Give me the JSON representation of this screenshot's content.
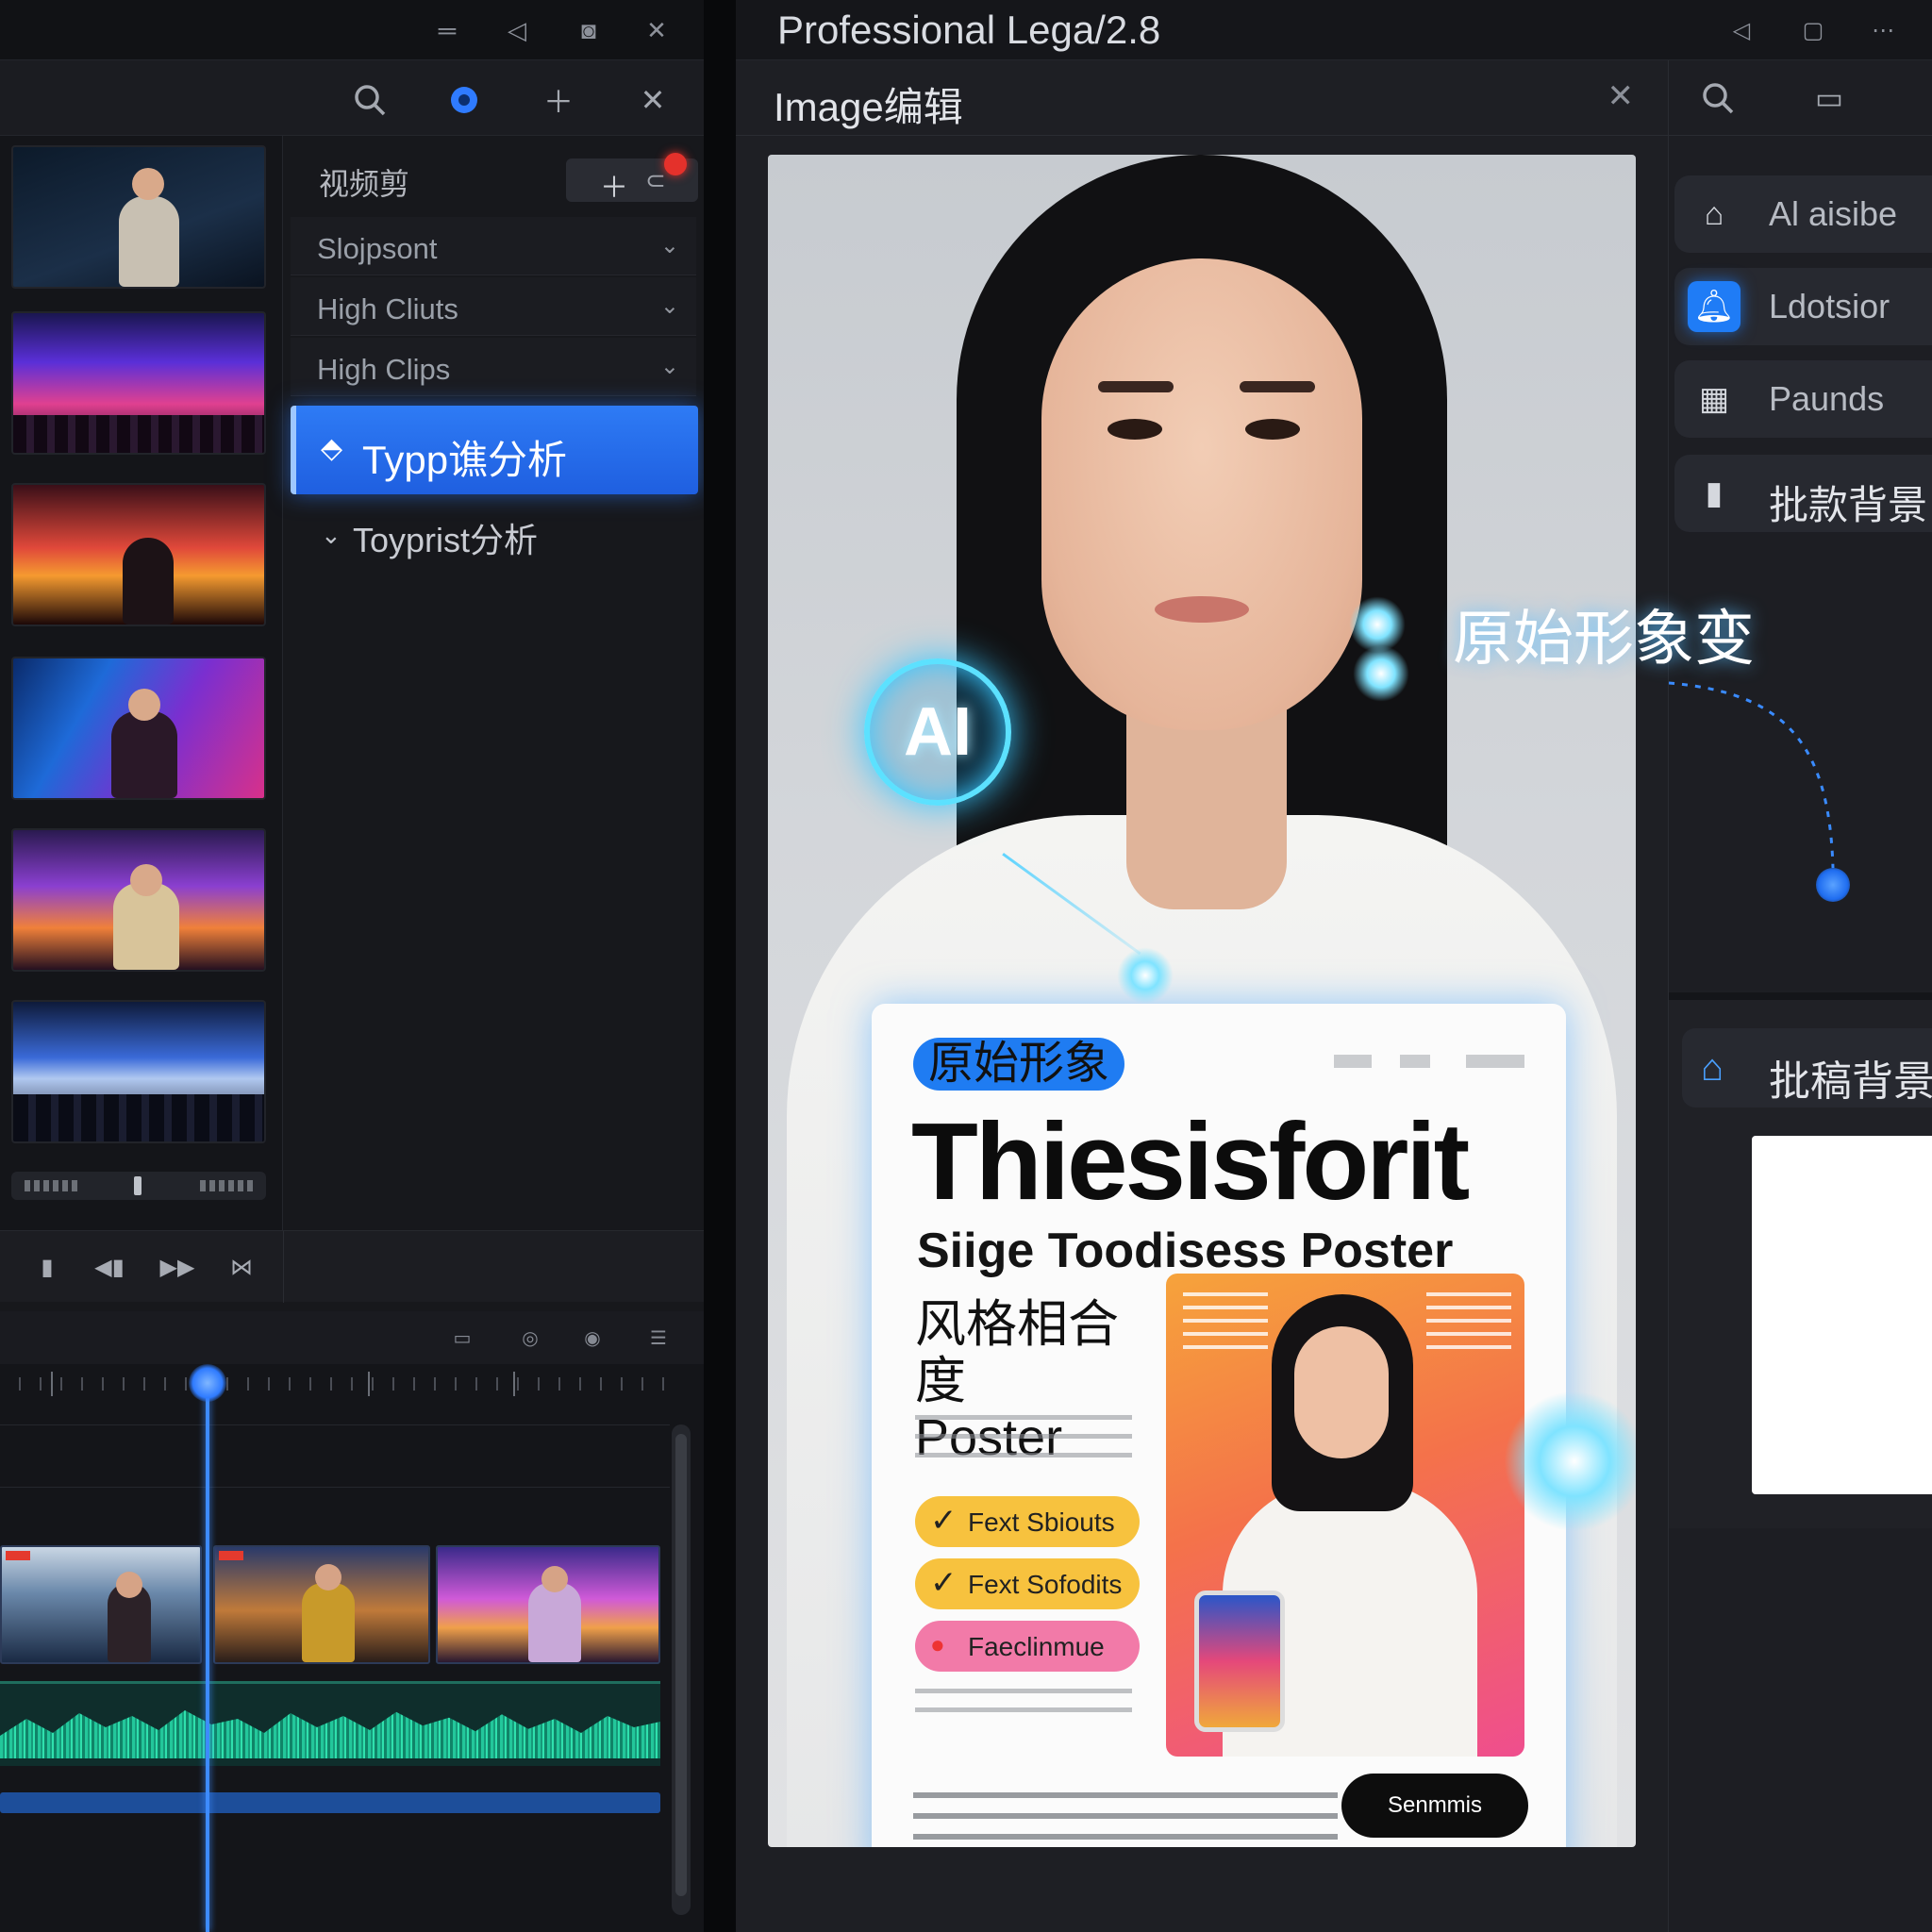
{
  "left_window": {
    "clips_panel": {
      "title": "视频剪",
      "rows": [
        "Slojpsont",
        "High Cliuts",
        "High Clips"
      ],
      "selected": "Typp谯分析",
      "sub_item": "Toyprist分析"
    },
    "icons": {
      "title_controls": [
        "minimize-icon",
        "send-icon",
        "restore-icon",
        "close-icon"
      ],
      "toolbar": [
        "search-icon",
        "shield-icon",
        "add-icon",
        "close-icon"
      ],
      "transport": [
        "play-icon",
        "step-back-icon",
        "fast-forward-icon",
        "skip-end-icon"
      ]
    },
    "colors": {
      "accent": "#2e7bf5",
      "playhead": "#3d8bff",
      "audio_wave": "#23c79b",
      "record": "#e4312b"
    }
  },
  "right_window": {
    "title": "Professional Lega/2.8",
    "editor_title": "Image编辑",
    "canvas": {
      "ai_badge": "AI",
      "overlay_label": "原始形象变",
      "poster": {
        "pill": "原始形象",
        "headline": "Thiesisforit",
        "subheadline": "Siige Toodisess Poster",
        "cn_title": "风格相合度\nPoster",
        "features": [
          {
            "label": "Fext Sbiouts",
            "color": "#f7c23e"
          },
          {
            "label": "Fext Sofodits",
            "color": "#f7c23e"
          },
          {
            "label": "Faeclinmue",
            "color": "#f27aa8"
          }
        ],
        "cta": "Senmmis"
      }
    },
    "side_panel": {
      "items": [
        {
          "label": "Al aisibe",
          "icon": "home-icon"
        },
        {
          "label": "Ldotsior",
          "icon": "bell-icon"
        },
        {
          "label": "Paunds",
          "icon": "gift-icon"
        },
        {
          "label": "批款背景",
          "icon": "book-icon"
        }
      ],
      "section_button": "批稿背景"
    }
  }
}
